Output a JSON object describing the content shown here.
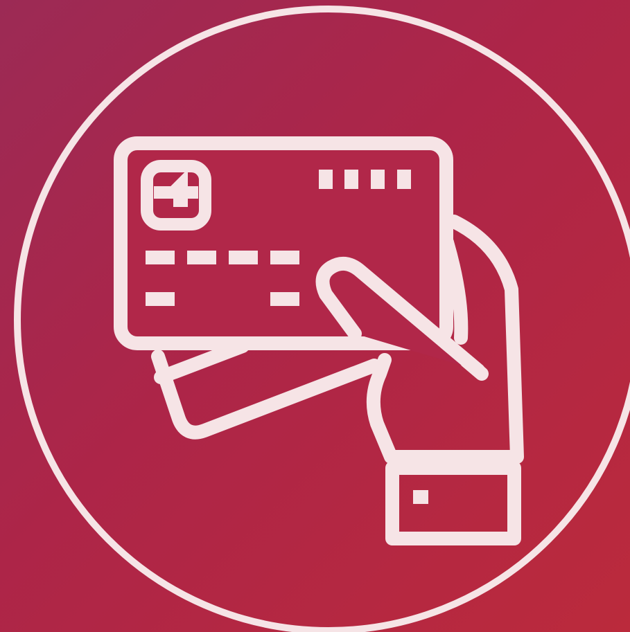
{
  "icon": {
    "name": "hand-holding-credit-card-icon",
    "line_color": "#f6e4e6",
    "background_gradient": [
      "#9c2a55",
      "#ad2548",
      "#bb2a3c"
    ]
  }
}
